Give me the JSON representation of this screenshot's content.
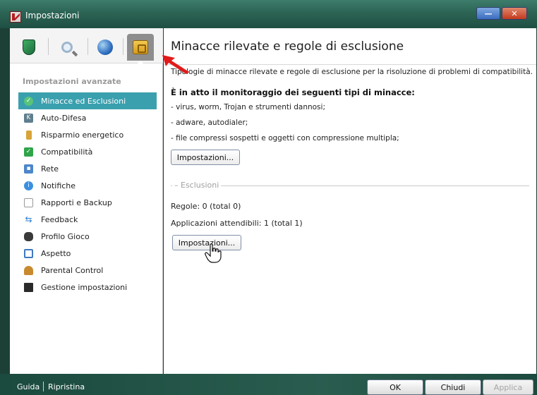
{
  "window": {
    "title": "Impostazioni"
  },
  "sidebar": {
    "section_title": "Impostazioni avanzate",
    "items": [
      {
        "label": "Minacce ed Esclusioni",
        "icon": "green-check-shield-icon",
        "active": true
      },
      {
        "label": "Auto-Difesa",
        "icon": "self-defense-icon"
      },
      {
        "label": "Risparmio energetico",
        "icon": "battery-icon"
      },
      {
        "label": "Compatibilità",
        "icon": "compatibility-check-icon"
      },
      {
        "label": "Rete",
        "icon": "network-computer-icon"
      },
      {
        "label": "Notifiche",
        "icon": "info-bubble-icon"
      },
      {
        "label": "Rapporti e Backup",
        "icon": "report-document-icon"
      },
      {
        "label": "Feedback",
        "icon": "arrows-exchange-icon"
      },
      {
        "label": "Profilo Gioco",
        "icon": "gamepad-icon"
      },
      {
        "label": "Aspetto",
        "icon": "window-appearance-icon"
      },
      {
        "label": "Parental Control",
        "icon": "parental-person-icon"
      },
      {
        "label": "Gestione impostazioni",
        "icon": "floppy-disk-icon"
      }
    ]
  },
  "toolbar": {
    "tabs": [
      "protection-shield-icon",
      "scan-magnifier-icon",
      "update-globe-icon",
      "advanced-safe-icon"
    ],
    "active_index": 3
  },
  "main": {
    "title": "Minacce rilevate e regole di esclusione",
    "description": "Tipologie di minacce rilevate e regole di esclusione per la risoluzione di problemi di compatibilità.",
    "monitoring_heading": "È in atto il monitoraggio dei seguenti tipi di minacce:",
    "threat_lines": [
      "- virus, worm, Trojan e strumenti dannosi;",
      "- adware, autodialer;",
      "- file compressi sospetti e oggetti con compressione multipla;"
    ],
    "settings_button_1": "Impostazioni...",
    "exclusions_group": "Esclusioni",
    "rules_line": "Regole: 0 (total 0)",
    "trusted_apps_line": "Applicazioni attendibili: 1 (total 1)",
    "settings_button_2": "Impostazioni..."
  },
  "footer": {
    "help_link": "Guida",
    "restore_link": "Ripristina",
    "ok_button": "OK",
    "close_button": "Chiudi",
    "apply_button": "Applica"
  },
  "colors": {
    "accent_active_nav": "#3aa0ae",
    "titlebar": "#2c6454",
    "annotation_arrow": "#e01b1b"
  }
}
